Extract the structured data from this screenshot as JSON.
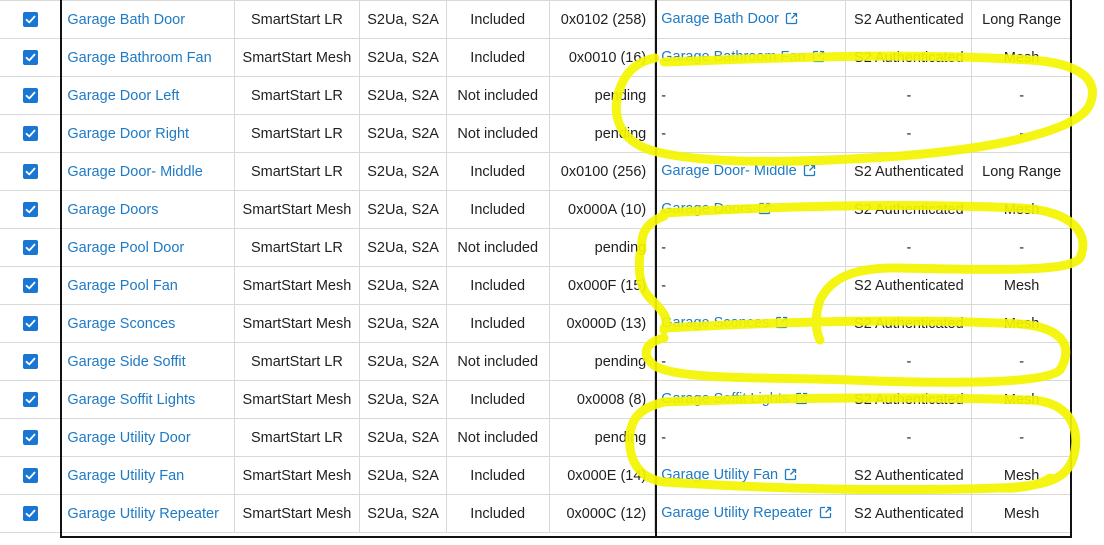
{
  "rows": [
    {
      "checked": true,
      "name": "Garage Bath Door",
      "provisioning": "SmartStart LR",
      "security_classes": "S2Ua, S2A",
      "status": "Included",
      "node": "0x0102 (258)",
      "link": "Garage Bath Door",
      "auth": "S2 Authenticated",
      "protocol": "Long Range"
    },
    {
      "checked": true,
      "name": "Garage Bathroom Fan",
      "provisioning": "SmartStart Mesh",
      "security_classes": "S2Ua, S2A",
      "status": "Included",
      "node": "0x0010 (16)",
      "link": "Garage Bathroom Fan",
      "auth": "S2 Authenticated",
      "protocol": "Mesh"
    },
    {
      "checked": true,
      "name": "Garage Door Left",
      "provisioning": "SmartStart LR",
      "security_classes": "S2Ua, S2A",
      "status": "Not included",
      "node": "pending",
      "link": "-",
      "auth": "-",
      "protocol": "-"
    },
    {
      "checked": true,
      "name": "Garage Door Right",
      "provisioning": "SmartStart LR",
      "security_classes": "S2Ua, S2A",
      "status": "Not included",
      "node": "pending",
      "link": "-",
      "auth": "-",
      "protocol": "-"
    },
    {
      "checked": true,
      "name": "Garage Door- Middle",
      "provisioning": "SmartStart LR",
      "security_classes": "S2Ua, S2A",
      "status": "Included",
      "node": "0x0100 (256)",
      "link": "Garage Door- Middle",
      "auth": "S2 Authenticated",
      "protocol": "Long Range"
    },
    {
      "checked": true,
      "name": "Garage Doors",
      "provisioning": "SmartStart Mesh",
      "security_classes": "S2Ua, S2A",
      "status": "Included",
      "node": "0x000A (10)",
      "link": "Garage Doors",
      "auth": "S2 Authenticated",
      "protocol": "Mesh"
    },
    {
      "checked": true,
      "name": "Garage Pool Door",
      "provisioning": "SmartStart LR",
      "security_classes": "S2Ua, S2A",
      "status": "Not included",
      "node": "pending",
      "link": "-",
      "auth": "-",
      "protocol": "-"
    },
    {
      "checked": true,
      "name": "Garage Pool Fan",
      "provisioning": "SmartStart Mesh",
      "security_classes": "S2Ua, S2A",
      "status": "Included",
      "node": "0x000F (15)",
      "link": "-",
      "auth": "S2 Authenticated",
      "protocol": "Mesh"
    },
    {
      "checked": true,
      "name": "Garage Sconces",
      "provisioning": "SmartStart Mesh",
      "security_classes": "S2Ua, S2A",
      "status": "Included",
      "node": "0x000D (13)",
      "link": "Garage Sconces",
      "auth": "S2 Authenticated",
      "protocol": "Mesh"
    },
    {
      "checked": true,
      "name": "Garage Side Soffit",
      "provisioning": "SmartStart LR",
      "security_classes": "S2Ua, S2A",
      "status": "Not included",
      "node": "pending",
      "link": "-",
      "auth": "-",
      "protocol": "-"
    },
    {
      "checked": true,
      "name": "Garage Soffit Lights",
      "provisioning": "SmartStart Mesh",
      "security_classes": "S2Ua, S2A",
      "status": "Included",
      "node": "0x0008 (8)",
      "link": "Garage Soffit Lights",
      "auth": "S2 Authenticated",
      "protocol": "Mesh"
    },
    {
      "checked": true,
      "name": "Garage Utility Door",
      "provisioning": "SmartStart LR",
      "security_classes": "S2Ua, S2A",
      "status": "Not included",
      "node": "pending",
      "link": "-",
      "auth": "-",
      "protocol": "-"
    },
    {
      "checked": true,
      "name": "Garage Utility Fan",
      "provisioning": "SmartStart Mesh",
      "security_classes": "S2Ua, S2A",
      "status": "Included",
      "node": "0x000E (14)",
      "link": "Garage Utility Fan",
      "auth": "S2 Authenticated",
      "protocol": "Mesh"
    },
    {
      "checked": true,
      "name": "Garage Utility Repeater",
      "provisioning": "SmartStart Mesh",
      "security_classes": "S2Ua, S2A",
      "status": "Included",
      "node": "0x000C (12)",
      "link": "Garage Utility Repeater",
      "auth": "S2 Authenticated",
      "protocol": "Mesh"
    }
  ],
  "colors": {
    "link": "#1f7ac4",
    "checkbox": "#1976d2",
    "highlight_annotation": "#f5f500"
  },
  "icons": {
    "checkbox": "checkbox-checked-icon",
    "external_link": "external-link-icon"
  }
}
